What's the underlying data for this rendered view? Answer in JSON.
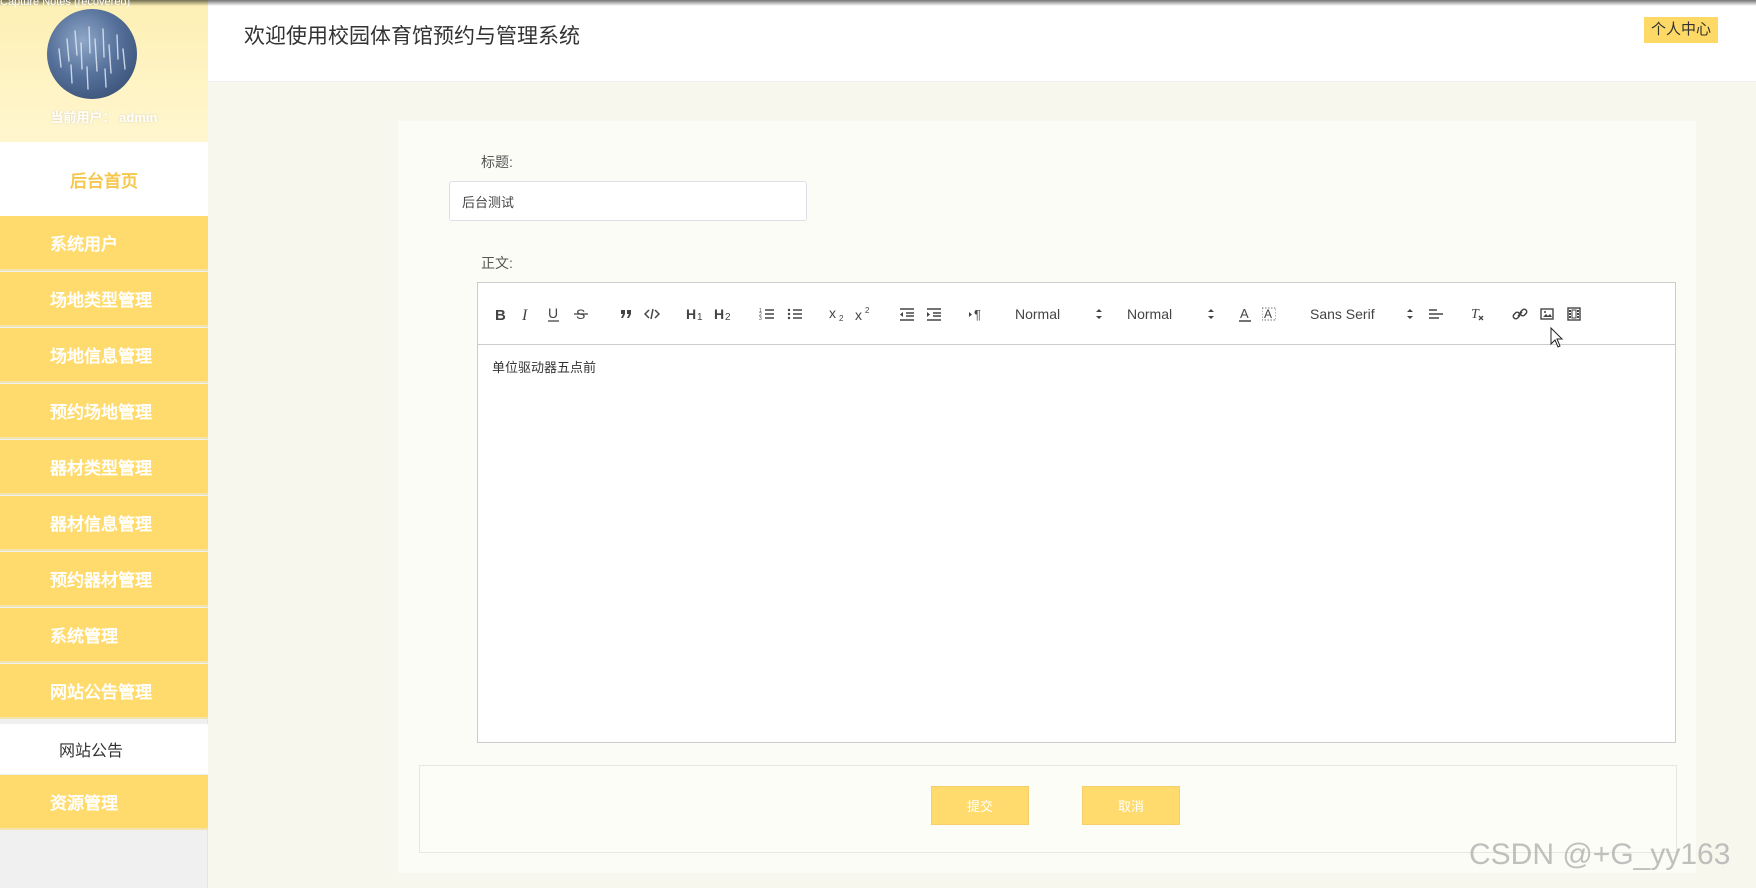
{
  "capture_label": "Capture Notes (recovered)",
  "sidebar": {
    "user_label": "当前用户： admin",
    "home_label": "后台首页",
    "items": [
      {
        "label": "系统用户"
      },
      {
        "label": "场地类型管理"
      },
      {
        "label": "场地信息管理"
      },
      {
        "label": "预约场地管理"
      },
      {
        "label": "器材类型管理"
      },
      {
        "label": "器材信息管理"
      },
      {
        "label": "预约器材管理"
      },
      {
        "label": "系统管理"
      },
      {
        "label": "网站公告管理"
      }
    ],
    "submenu": {
      "label": "网站公告"
    },
    "last_item": {
      "label": "资源管理"
    }
  },
  "header": {
    "title": "欢迎使用校园体育馆预约与管理系统",
    "profile_label": "个人中心"
  },
  "form": {
    "title_label": "标题:",
    "title_value": "后台测试",
    "body_label": "正文:",
    "body_text": "单位驱动器五点前",
    "submit_label": "提交",
    "cancel_label": "取消"
  },
  "toolbar": {
    "header_size": "Normal",
    "font_size": "Normal",
    "font_family": "Sans Serif"
  },
  "watermark": "CSDN @+G_yy163",
  "colors": {
    "accent": "#ffdb6e",
    "home_text": "#f5c74d",
    "background": "#f7f7ee"
  }
}
